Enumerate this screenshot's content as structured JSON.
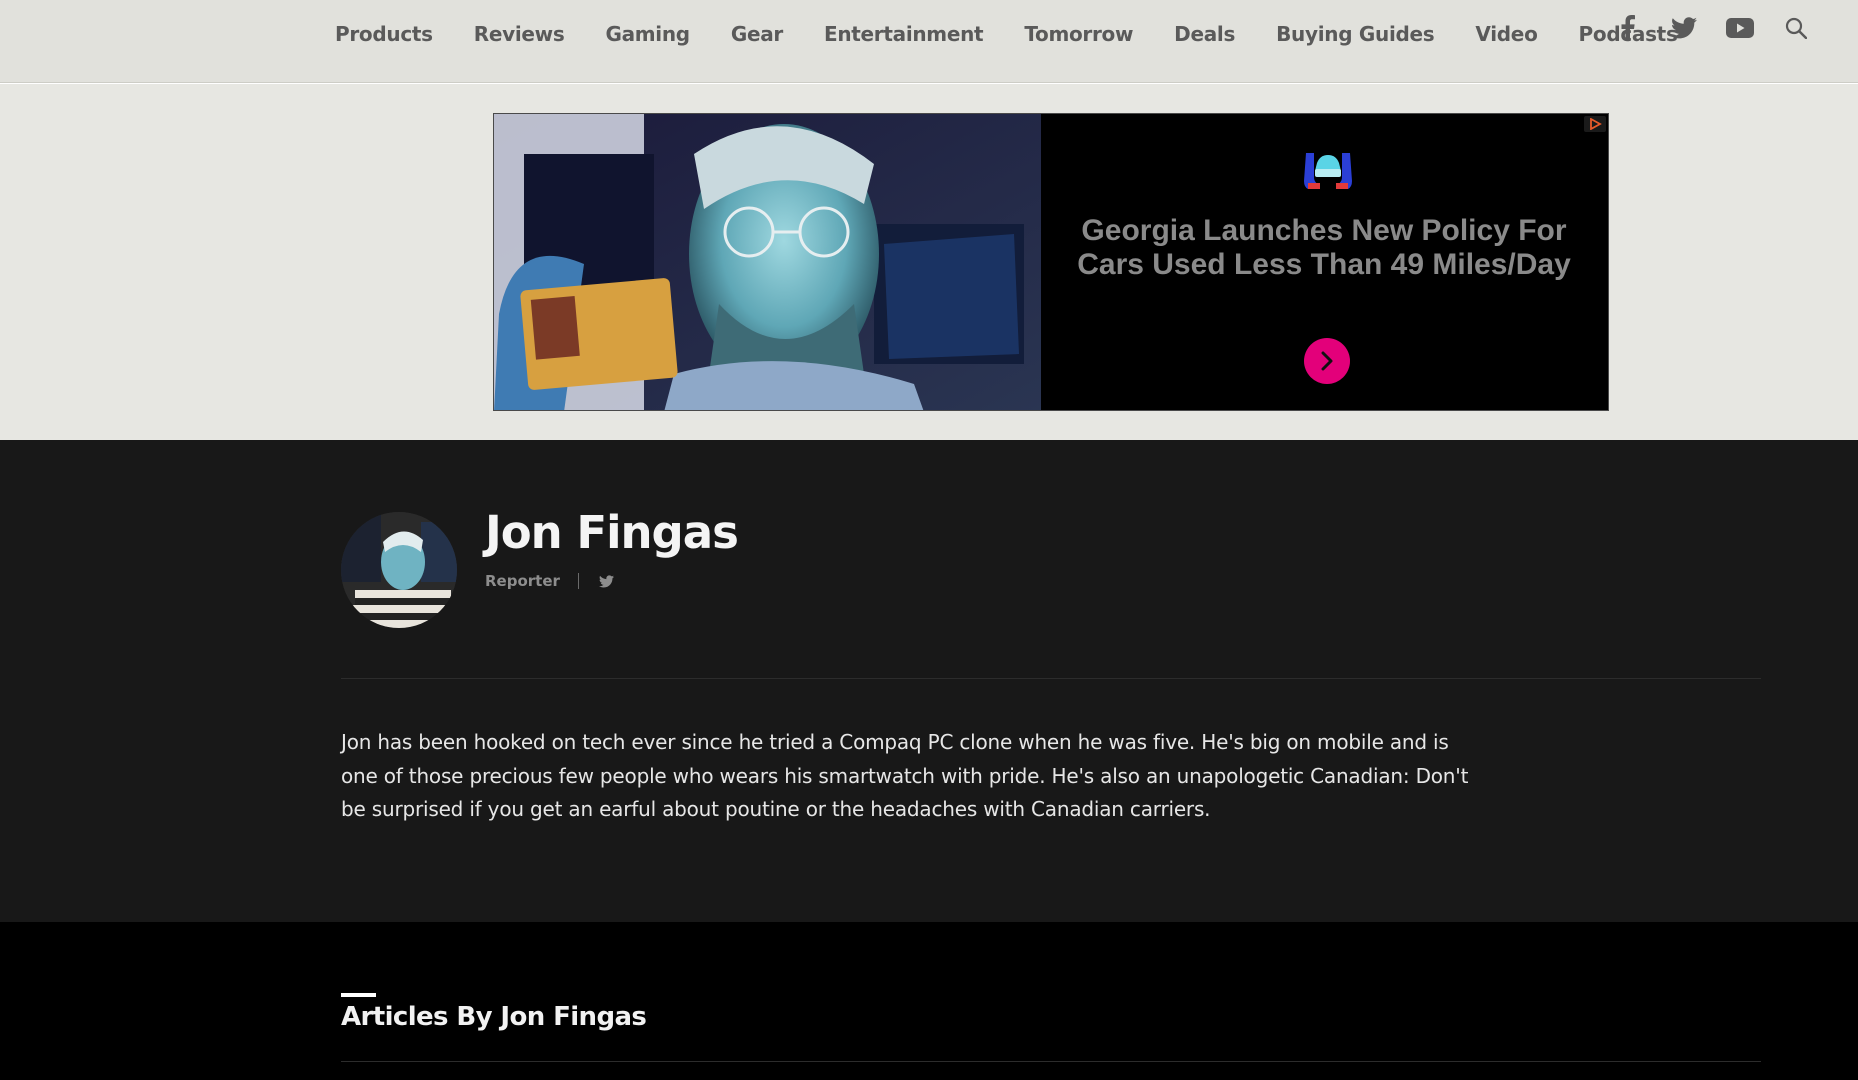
{
  "nav": {
    "links": [
      "Products",
      "Reviews",
      "Gaming",
      "Gear",
      "Entertainment",
      "Tomorrow",
      "Deals",
      "Buying Guides",
      "Video",
      "Podcasts"
    ],
    "icons": [
      "facebook-icon",
      "twitter-icon",
      "youtube-icon",
      "search-icon"
    ]
  },
  "ad": {
    "headline": "Georgia Launches New Policy For Cars Used Less Than 49 Miles/Day",
    "accent_color": "#e3007a",
    "icons": [
      "car-insurance-logo-icon",
      "chevron-right-icon",
      "ad-choices-icon"
    ]
  },
  "author": {
    "name": "Jon Fingas",
    "role": "Reporter",
    "bio": "Jon has been hooked on tech ever since he tried a Compaq PC clone when he was five. He's big on mobile and is one of those precious few people who wears his smartwatch with pride. He's also an unapologetic Canadian: Don't be surprised if you get an earful about poutine or the headaches with Canadian carriers."
  },
  "articles": {
    "heading": "Articles By Jon Fingas"
  },
  "colors": {
    "nav_bg": "#e1e1dc",
    "author_bg": "#181818",
    "articles_bg": "#000000"
  }
}
